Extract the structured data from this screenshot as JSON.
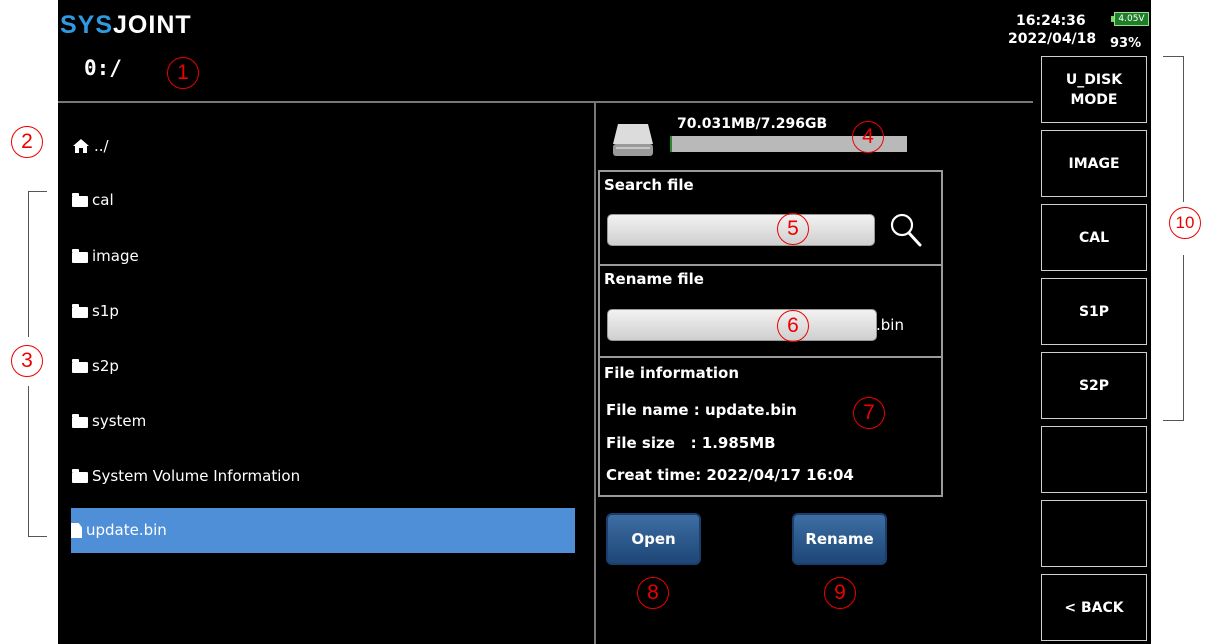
{
  "header": {
    "logo_prefix": "SYS",
    "logo_suffix": "JOINT",
    "path": "0:/",
    "time": "16:24:36",
    "date": "2022/04/18",
    "battery_voltage": "4.05V",
    "battery_percent": "93%"
  },
  "file_list": {
    "parent": "../",
    "items": [
      {
        "name": "cal",
        "type": "folder"
      },
      {
        "name": "image",
        "type": "folder"
      },
      {
        "name": "s1p",
        "type": "folder"
      },
      {
        "name": "s2p",
        "type": "folder"
      },
      {
        "name": "system",
        "type": "folder"
      },
      {
        "name": "System Volume Information",
        "type": "folder"
      },
      {
        "name": "update.bin",
        "type": "file",
        "selected": true
      }
    ]
  },
  "storage": {
    "label": "70.031MB/7.296GB",
    "used_fraction": 0.0096
  },
  "search": {
    "title": "Search file",
    "value": ""
  },
  "rename": {
    "title": "Rename file",
    "value": "",
    "extension": ".bin"
  },
  "file_info": {
    "title": "File information",
    "name_line": "File name : update.bin",
    "size_line": "File size   : 1.985MB",
    "time_line": "Creat time: 2022/04/17 16:04"
  },
  "buttons": {
    "open": "Open",
    "rename": "Rename"
  },
  "softkeys": {
    "u_disk_line1": "U_DISK",
    "u_disk_line2": "MODE",
    "image": "IMAGE",
    "cal": "CAL",
    "s1p": "S1P",
    "s2p": "S2P",
    "empty1": "",
    "empty2": "",
    "back": "< BACK"
  },
  "callouts": [
    "1",
    "2",
    "3",
    "4",
    "5",
    "6",
    "7",
    "8",
    "9",
    "10"
  ],
  "colors": {
    "selection": "#4f8fd7",
    "callout": "#e00000",
    "logo_accent": "#2f9ae0",
    "button": "#2d5a8e"
  }
}
